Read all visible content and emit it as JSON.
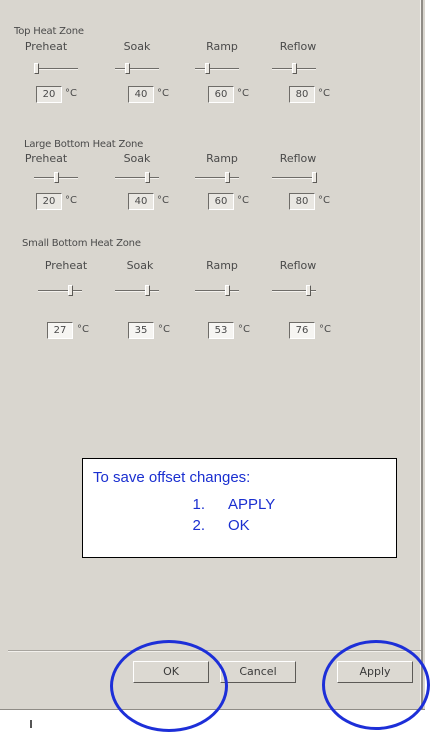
{
  "window": {
    "title": ""
  },
  "zones": [
    {
      "title": "Top Heat Zone",
      "settings": [
        {
          "label": "Preheat",
          "value": "20",
          "unit": "°C",
          "slider_level": 0.0
        },
        {
          "label": "Soak",
          "value": "40",
          "unit": "°C",
          "slider_level": 0.25
        },
        {
          "label": "Ramp",
          "value": "60",
          "unit": "°C",
          "slider_level": 0.25
        },
        {
          "label": "Reflow",
          "value": "80",
          "unit": "°C",
          "slider_level": 0.5
        }
      ]
    },
    {
      "title": "Large Bottom Heat Zone",
      "settings": [
        {
          "label": "Preheat",
          "value": "20",
          "unit": "°C",
          "slider_level": 0.5
        },
        {
          "label": "Soak",
          "value": "40",
          "unit": "°C",
          "slider_level": 0.75
        },
        {
          "label": "Ramp",
          "value": "60",
          "unit": "°C",
          "slider_level": 0.75
        },
        {
          "label": "Reflow",
          "value": "80",
          "unit": "°C",
          "slider_level": 1.0
        }
      ]
    },
    {
      "title": "Small Bottom Heat Zone",
      "settings": [
        {
          "label": "Preheat",
          "value": "27",
          "unit": "°C",
          "slider_level": 0.75
        },
        {
          "label": "Soak",
          "value": "35",
          "unit": "°C",
          "slider_level": 0.75
        },
        {
          "label": "Ramp",
          "value": "53",
          "unit": "°C",
          "slider_level": 0.75
        },
        {
          "label": "Reflow",
          "value": "76",
          "unit": "°C",
          "slider_level": 0.85
        }
      ]
    }
  ],
  "note": {
    "heading": "To save offset changes:",
    "steps": [
      {
        "number": "1.",
        "text": "APPLY"
      },
      {
        "number": "2.",
        "text": "OK"
      }
    ],
    "text_color": "#1a2fd0"
  },
  "buttons": {
    "ok": "OK",
    "cancel": "Cancel",
    "apply": "Apply"
  },
  "highlight_color": "#1d2fd8"
}
